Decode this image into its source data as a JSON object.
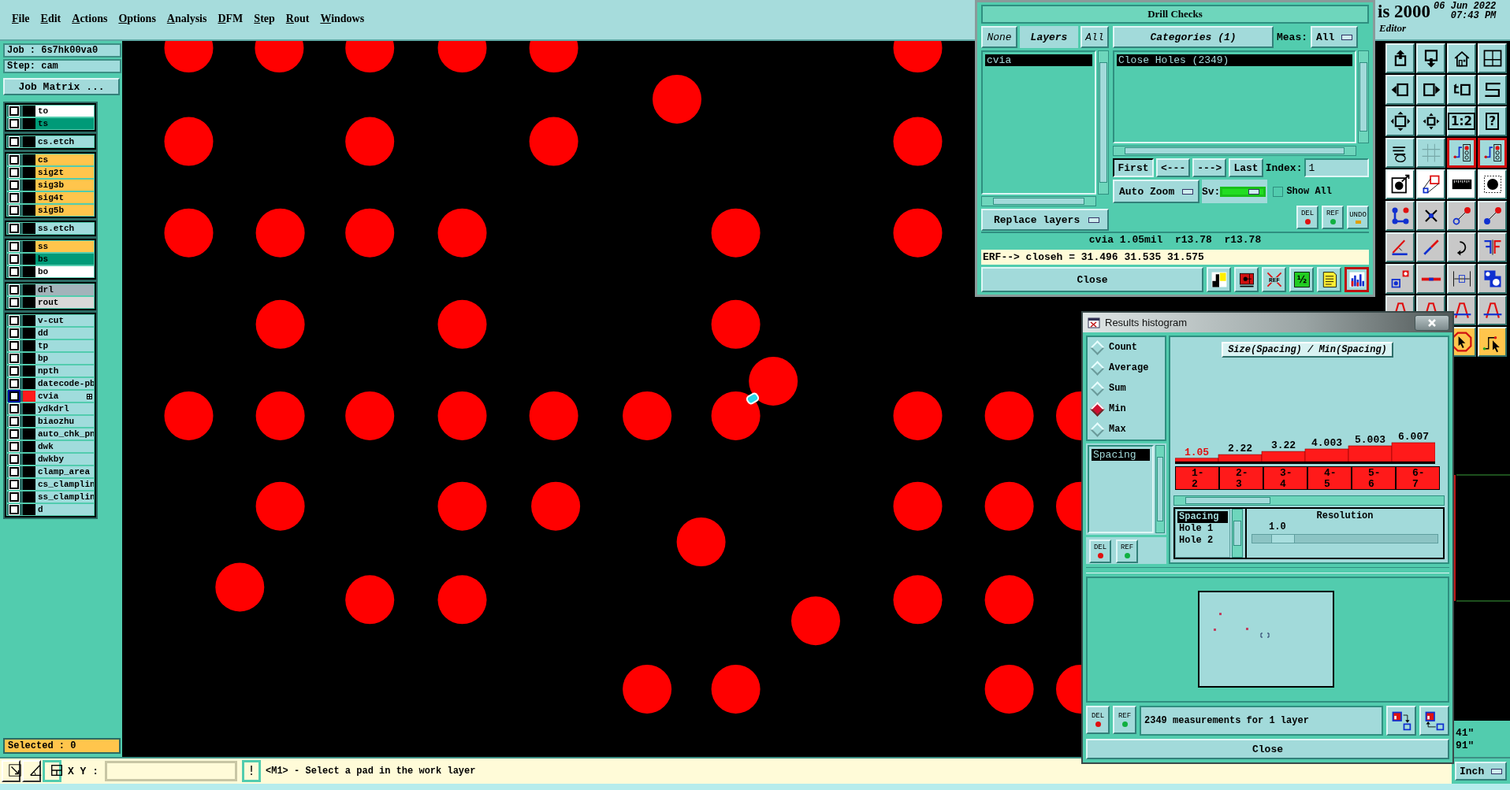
{
  "menu_bar": {
    "items": [
      "File",
      "Edit",
      "Actions",
      "Options",
      "Analysis",
      "DFM",
      "Step",
      "Rout",
      "Windows"
    ],
    "app_title": "is 2000",
    "subtitle": "Editor",
    "date": "06 Jun 2022",
    "time": "07:43 PM"
  },
  "left_panel": {
    "job": "Job : 6s7hk00va0",
    "step": "Step: cam",
    "job_matrix_button": "Job Matrix ...",
    "layer_groups": [
      {
        "layers": [
          {
            "name": "to",
            "color": "#ffffff",
            "checked": false,
            "work": false
          },
          {
            "name": "ts",
            "color": "#009a78",
            "checked": false,
            "work": false
          }
        ]
      },
      {
        "layers": [
          {
            "name": "cs.etch",
            "color": "#a0dcdc",
            "checked": false,
            "work": false
          }
        ]
      },
      {
        "layers": [
          {
            "name": "cs",
            "color": "#ffc54c",
            "checked": false,
            "work": false
          },
          {
            "name": "sig2t",
            "color": "#ffc54c",
            "checked": false,
            "work": false
          },
          {
            "name": "sig3b",
            "color": "#ffc54c",
            "checked": false,
            "work": false
          },
          {
            "name": "sig4t",
            "color": "#ffc54c",
            "checked": false,
            "work": false
          },
          {
            "name": "sig5b",
            "color": "#ffc54c",
            "checked": false,
            "work": false
          }
        ]
      },
      {
        "layers": [
          {
            "name": "ss.etch",
            "color": "#a0dcdc",
            "checked": false,
            "work": false
          }
        ]
      },
      {
        "layers": [
          {
            "name": "ss",
            "color": "#ffc54c",
            "checked": false,
            "work": false
          },
          {
            "name": "bs",
            "color": "#009a78",
            "checked": false,
            "work": false
          },
          {
            "name": "bo",
            "color": "#ffffff",
            "checked": false,
            "work": false
          }
        ]
      },
      {
        "layers": [
          {
            "name": "drl",
            "color": "#a3b3ba",
            "checked": false,
            "work": false
          },
          {
            "name": "rout",
            "color": "#d8d8d8",
            "checked": false,
            "work": false
          }
        ]
      },
      {
        "layers": [
          {
            "name": "v-cut",
            "color": "#a0dcdc",
            "checked": false,
            "work": false
          },
          {
            "name": "dd",
            "color": "#a0dcdc",
            "checked": false,
            "work": false
          },
          {
            "name": "tp",
            "color": "#a0dcdc",
            "checked": false,
            "work": false
          },
          {
            "name": "bp",
            "color": "#a0dcdc",
            "checked": false,
            "work": false
          },
          {
            "name": "npth",
            "color": "#a0dcdc",
            "checked": false,
            "work": false
          },
          {
            "name": "datecode-pb",
            "color": "#a0dcdc",
            "checked": false,
            "work": false
          },
          {
            "name": "cvia",
            "color": "#a0dcdc",
            "checked": false,
            "work": true
          },
          {
            "name": "ydkdrl",
            "color": "#a0dcdc",
            "checked": false,
            "work": false
          },
          {
            "name": "biaozhu",
            "color": "#a0dcdc",
            "checked": false,
            "work": false
          },
          {
            "name": "auto_chk_pn",
            "color": "#a0dcdc",
            "checked": false,
            "work": false
          },
          {
            "name": "dwk",
            "color": "#a0dcdc",
            "checked": false,
            "work": false
          },
          {
            "name": "dwkby",
            "color": "#a0dcdc",
            "checked": false,
            "work": false
          },
          {
            "name": "clamp_area",
            "color": "#a0dcdc",
            "checked": false,
            "work": false
          },
          {
            "name": "cs_clamplin",
            "color": "#a0dcdc",
            "checked": false,
            "work": false
          },
          {
            "name": "ss_clamplin",
            "color": "#a0dcdc",
            "checked": false,
            "work": false
          },
          {
            "name": "d",
            "color": "#a0dcdc",
            "checked": false,
            "work": false
          }
        ]
      }
    ],
    "selected_count": "Selected : 0"
  },
  "toolbar": {
    "rows": [
      {
        "kind": "view",
        "buttons": [
          {
            "kind": "upload",
            "active": false
          },
          {
            "kind": "download",
            "active": false
          },
          {
            "kind": "home",
            "active": false
          },
          {
            "kind": "window-grid",
            "active": false
          }
        ]
      },
      {
        "kind": "view",
        "buttons": [
          {
            "kind": "box-left",
            "active": false
          },
          {
            "kind": "box-right",
            "active": false
          },
          {
            "kind": "box-return",
            "active": false
          },
          {
            "kind": "s-path",
            "active": false
          }
        ]
      },
      {
        "kind": "view",
        "buttons": [
          {
            "kind": "expand",
            "active": false
          },
          {
            "kind": "center",
            "active": false
          },
          {
            "kind": "text",
            "label": "1:2",
            "active": false
          },
          {
            "kind": "text",
            "label": "?",
            "active": false
          }
        ]
      },
      {
        "kind": "view",
        "buttons": [
          {
            "kind": "tools",
            "active": false
          },
          {
            "kind": "grid",
            "active": false
          },
          {
            "kind": "circuit",
            "active": true
          },
          {
            "kind": "circuit",
            "active": true
          }
        ]
      },
      {
        "kind": "measure",
        "buttons": [
          {
            "kind": "pad-arrow",
            "active": false
          },
          {
            "kind": "shapes",
            "active": false
          },
          {
            "kind": "ruler",
            "active": false
          },
          {
            "kind": "pad-square",
            "active": false
          }
        ]
      },
      {
        "kind": "edit",
        "buttons": [
          {
            "kind": "nodes",
            "active": false
          },
          {
            "kind": "cross",
            "active": false
          },
          {
            "kind": "link",
            "active": false
          },
          {
            "kind": "link-filled",
            "active": false
          }
        ]
      },
      {
        "kind": "edit",
        "buttons": [
          {
            "kind": "angle",
            "active": false
          },
          {
            "kind": "diagonal",
            "active": false
          },
          {
            "kind": "rotate",
            "active": false
          },
          {
            "kind": "mirror",
            "active": false
          }
        ]
      },
      {
        "kind": "edit",
        "buttons": [
          {
            "kind": "pad-move",
            "active": false
          },
          {
            "kind": "line",
            "active": false
          },
          {
            "kind": "measure",
            "active": false
          },
          {
            "kind": "pad-group",
            "active": false
          }
        ]
      },
      {
        "kind": "edit",
        "buttons": [
          {
            "kind": "arch",
            "active": false
          },
          {
            "kind": "arch",
            "active": false
          },
          {
            "kind": "arch",
            "active": false
          },
          {
            "kind": "arch",
            "active": false
          }
        ]
      },
      {
        "kind": "select",
        "buttons": [
          {
            "kind": "pointer",
            "active": false
          },
          {
            "kind": "pointer-route",
            "active": false
          }
        ]
      }
    ]
  },
  "coordinates": [
    "41\"",
    "91\""
  ],
  "drill_checks": {
    "title": "Drill Checks",
    "none_button": "None",
    "layers_label": "Layers",
    "all_button": "All",
    "layers": [
      {
        "name": "cvia",
        "selected": true
      }
    ],
    "categories_button": "Categories (1)",
    "meas_label": "Meas:",
    "meas_value": "All",
    "categories": [
      {
        "name": "Close Holes (2349)",
        "selected": true
      }
    ],
    "nav_buttons": [
      {
        "label": "First",
        "pressed": true
      },
      {
        "label": "<---",
        "pressed": false
      },
      {
        "label": "--->",
        "pressed": false
      },
      {
        "label": "Last",
        "pressed": false
      }
    ],
    "index_label": "Index:",
    "index_value": "1",
    "auto_zoom": "Auto Zoom",
    "sv_label": "Sv:",
    "show_all": {
      "label": "Show All",
      "checked": false
    },
    "replace_layers": "Replace layers",
    "action_buttons": [
      {
        "kind": "del",
        "label": "DEL"
      },
      {
        "kind": "ref",
        "label": "REF"
      },
      {
        "kind": "undo",
        "label": "UNDO"
      }
    ],
    "info": "cvia 1.05mil  r13.78  r13.78",
    "erf": "ERF--> closeh = 31.496 31.535 31.575",
    "close": "Close",
    "tools": [
      {
        "kind": "profile",
        "active": false
      },
      {
        "kind": "highlight",
        "active": false
      },
      {
        "kind": "ref-cross",
        "label": "REF",
        "active": false
      },
      {
        "kind": "half",
        "label": "½",
        "active": false
      },
      {
        "kind": "notes",
        "active": false
      },
      {
        "kind": "chart",
        "active": true
      }
    ]
  },
  "results_histogram": {
    "title": "Results histogram",
    "modes": [
      {
        "label": "Count",
        "selected": false
      },
      {
        "label": "Average",
        "selected": false
      },
      {
        "label": "Sum",
        "selected": false
      },
      {
        "label": "Min",
        "selected": true
      },
      {
        "label": "Max",
        "selected": false
      }
    ],
    "measures": [
      {
        "name": "Spacing",
        "selected": true
      }
    ],
    "side_buttons": [
      {
        "kind": "del",
        "label": "DEL"
      },
      {
        "kind": "ref",
        "label": "REF"
      }
    ],
    "chart_data": {
      "type": "bar",
      "title": "Size(Spacing) / Min(Spacing)",
      "categories": [
        "1-2",
        "2-3",
        "3-4",
        "4-5",
        "5-6",
        "6-7"
      ],
      "values": [
        1.05,
        2.22,
        3.22,
        4.003,
        5.003,
        6.007
      ],
      "data_labels": true
    },
    "fields": [
      {
        "name": "Spacing",
        "selected": true
      },
      {
        "name": "Hole 1",
        "selected": false
      },
      {
        "name": "Hole 2",
        "selected": false
      }
    ],
    "resolution_label": "Resolution",
    "resolution_value": "1.0",
    "resolution": {
      "level": 0.1
    },
    "bottom_buttons": [
      {
        "kind": "del",
        "label": "DEL"
      },
      {
        "kind": "ref",
        "label": "REF"
      }
    ],
    "summary": "2349 measurements for 1 layer",
    "close": "Close"
  },
  "status_bar": {
    "tools": [
      {
        "kind": "diagonal",
        "pressed": false
      },
      {
        "kind": "angle",
        "pressed": false
      },
      {
        "kind": "grid",
        "pressed": true
      }
    ],
    "xy_label": "X Y :",
    "message_button": "!",
    "message": "<M1> - Select a pad in the work layer",
    "units": "Inch"
  }
}
